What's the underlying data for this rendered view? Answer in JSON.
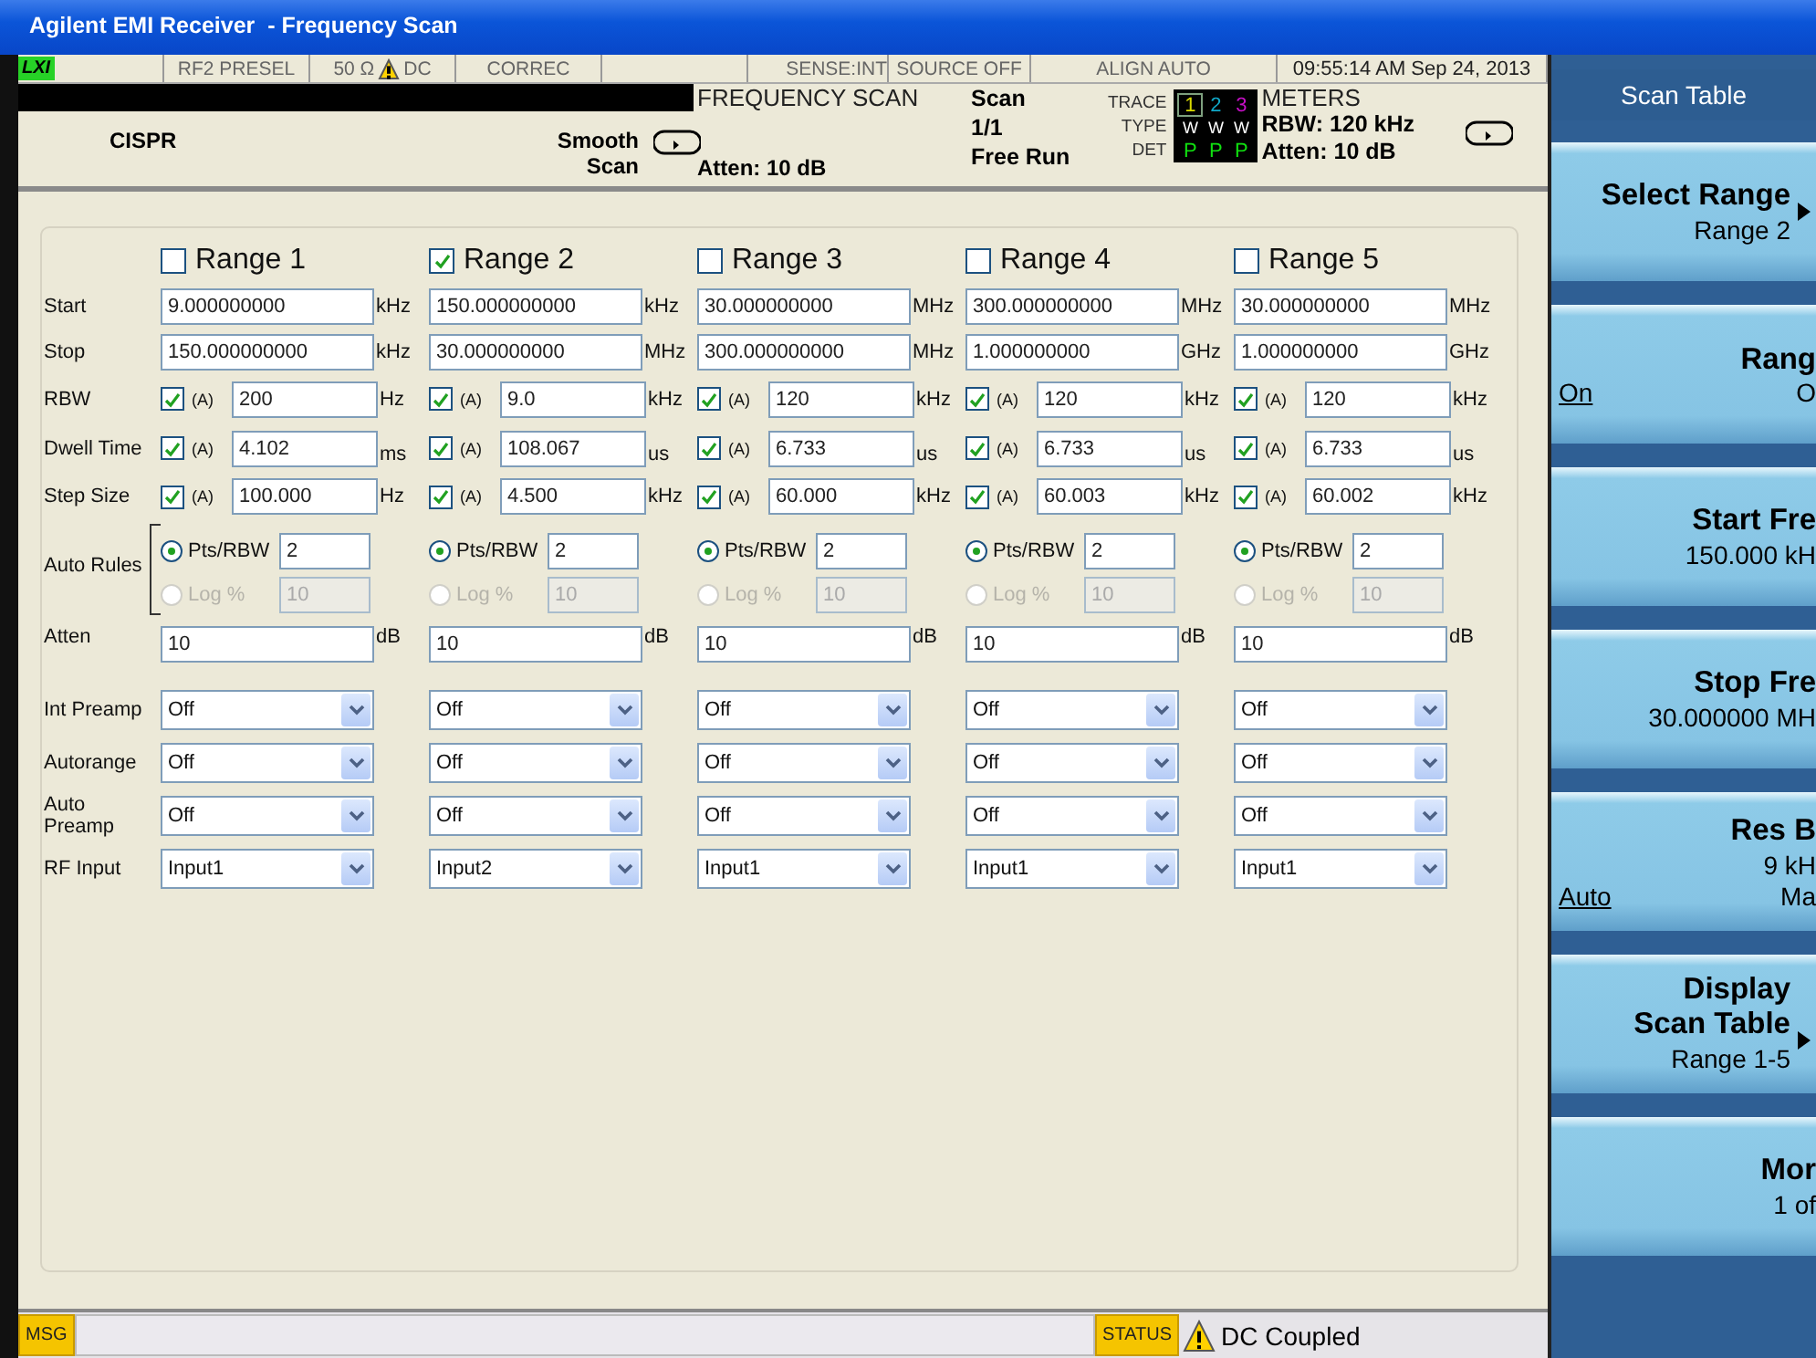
{
  "window": {
    "title": "Agilent EMI Receiver  - Frequency Scan"
  },
  "status_row": [
    {
      "kind": "logo",
      "text": "LXI"
    },
    {
      "kind": "text",
      "text": "RF2 PRESEL"
    },
    {
      "kind": "warning",
      "before": "50 Ω",
      "after": "DC"
    },
    {
      "kind": "text",
      "text": "CORREC"
    },
    {
      "kind": "blank"
    },
    {
      "kind": "text",
      "text": "SENSE:INT"
    },
    {
      "kind": "text",
      "text": "SOURCE OFF"
    },
    {
      "kind": "text",
      "text": "ALIGN AUTO"
    },
    {
      "kind": "text",
      "text": "09:55:14 AM Sep 24, 2013"
    }
  ],
  "annunciator": {
    "detector": "CISPR",
    "mode_top": "Smooth",
    "mode_bottom": "Scan",
    "measurement": "FREQUENCY SCAN",
    "atten": "Atten: 10 dB",
    "scan": [
      "Scan",
      "1/1",
      "Free Run"
    ],
    "trace_labels": [
      "TRACE",
      "TYPE",
      "DET"
    ],
    "traces": [
      {
        "number": "1",
        "selected": true,
        "color": "#d8d800",
        "type": "W",
        "det": "P"
      },
      {
        "number": "2",
        "selected": false,
        "color": "#10a8c8",
        "type": "W",
        "det": "P"
      },
      {
        "number": "3",
        "selected": false,
        "color": "#c810c8",
        "type": "W",
        "det": "P"
      }
    ],
    "meters": [
      "METERS",
      "RBW: 120 kHz",
      "Atten: 10 dB"
    ]
  },
  "table": {
    "ranges": [
      {
        "label": "Range 1",
        "checked": false
      },
      {
        "label": "Range 2",
        "checked": true
      },
      {
        "label": "Range 3",
        "checked": false
      },
      {
        "label": "Range 4",
        "checked": false
      },
      {
        "label": "Range 5",
        "checked": false
      }
    ],
    "rows": [
      {
        "kind": "value",
        "label": "Start",
        "cells": [
          {
            "value": "9.000000000",
            "unit": "kHz"
          },
          {
            "value": "150.000000000",
            "unit": "kHz"
          },
          {
            "value": "30.000000000",
            "unit": "MHz"
          },
          {
            "value": "300.000000000",
            "unit": "MHz"
          },
          {
            "value": "30.000000000",
            "unit": "MHz"
          }
        ]
      },
      {
        "kind": "value",
        "label": "Stop",
        "cells": [
          {
            "value": "150.000000000",
            "unit": "kHz"
          },
          {
            "value": "30.000000000",
            "unit": "MHz"
          },
          {
            "value": "300.000000000",
            "unit": "MHz"
          },
          {
            "value": "1.000000000",
            "unit": "GHz"
          },
          {
            "value": "1.000000000",
            "unit": "GHz"
          }
        ]
      },
      {
        "kind": "auto",
        "label": "RBW",
        "cells": [
          {
            "auto": true,
            "auto_label": "(A)",
            "value": "200",
            "unit": "Hz"
          },
          {
            "auto": true,
            "auto_label": "(A)",
            "value": "9.0",
            "unit": "kHz"
          },
          {
            "auto": true,
            "auto_label": "(A)",
            "value": "120",
            "unit": "kHz"
          },
          {
            "auto": true,
            "auto_label": "(A)",
            "value": "120",
            "unit": "kHz"
          },
          {
            "auto": true,
            "auto_label": "(A)",
            "value": "120",
            "unit": "kHz"
          }
        ]
      },
      {
        "kind": "auto",
        "label": "Dwell Time",
        "cells": [
          {
            "auto": true,
            "auto_label": "(A)",
            "value": "4.102",
            "unit": "ms"
          },
          {
            "auto": true,
            "auto_label": "(A)",
            "value": "108.067",
            "unit": "us"
          },
          {
            "auto": true,
            "auto_label": "(A)",
            "value": "6.733",
            "unit": "us"
          },
          {
            "auto": true,
            "auto_label": "(A)",
            "value": "6.733",
            "unit": "us"
          },
          {
            "auto": true,
            "auto_label": "(A)",
            "value": "6.733",
            "unit": "us"
          }
        ]
      },
      {
        "kind": "auto",
        "label": "Step Size",
        "cells": [
          {
            "auto": true,
            "auto_label": "(A)",
            "value": "100.000",
            "unit": "Hz"
          },
          {
            "auto": true,
            "auto_label": "(A)",
            "value": "4.500",
            "unit": "kHz"
          },
          {
            "auto": true,
            "auto_label": "(A)",
            "value": "60.000",
            "unit": "kHz"
          },
          {
            "auto": true,
            "auto_label": "(A)",
            "value": "60.003",
            "unit": "kHz"
          },
          {
            "auto": true,
            "auto_label": "(A)",
            "value": "60.002",
            "unit": "kHz"
          }
        ]
      },
      {
        "kind": "rules",
        "label": "Auto Rules",
        "cells": [
          {
            "options": [
              {
                "label": "Pts/RBW",
                "selected": true,
                "disabled": false,
                "value": "2"
              },
              {
                "label": "Log %",
                "selected": false,
                "disabled": true,
                "value": "10"
              }
            ]
          },
          {
            "options": [
              {
                "label": "Pts/RBW",
                "selected": true,
                "disabled": false,
                "value": "2"
              },
              {
                "label": "Log %",
                "selected": false,
                "disabled": true,
                "value": "10"
              }
            ]
          },
          {
            "options": [
              {
                "label": "Pts/RBW",
                "selected": true,
                "disabled": false,
                "value": "2"
              },
              {
                "label": "Log %",
                "selected": false,
                "disabled": true,
                "value": "10"
              }
            ]
          },
          {
            "options": [
              {
                "label": "Pts/RBW",
                "selected": true,
                "disabled": false,
                "value": "2"
              },
              {
                "label": "Log %",
                "selected": false,
                "disabled": true,
                "value": "10"
              }
            ]
          },
          {
            "options": [
              {
                "label": "Pts/RBW",
                "selected": true,
                "disabled": false,
                "value": "2"
              },
              {
                "label": "Log %",
                "selected": false,
                "disabled": true,
                "value": "10"
              }
            ]
          }
        ]
      },
      {
        "kind": "value",
        "label": "Atten",
        "cells": [
          {
            "value": "10",
            "unit": "dB"
          },
          {
            "value": "10",
            "unit": "dB"
          },
          {
            "value": "10",
            "unit": "dB"
          },
          {
            "value": "10",
            "unit": "dB"
          },
          {
            "value": "10",
            "unit": "dB"
          }
        ]
      },
      {
        "kind": "dropdown",
        "label": "Int Preamp",
        "cells": [
          {
            "value": "Off"
          },
          {
            "value": "Off"
          },
          {
            "value": "Off"
          },
          {
            "value": "Off"
          },
          {
            "value": "Off"
          }
        ]
      },
      {
        "kind": "dropdown",
        "label": "Autorange",
        "cells": [
          {
            "value": "Off"
          },
          {
            "value": "Off"
          },
          {
            "value": "Off"
          },
          {
            "value": "Off"
          },
          {
            "value": "Off"
          }
        ]
      },
      {
        "kind": "dropdown",
        "label": "Auto Preamp",
        "cells": [
          {
            "value": "Off"
          },
          {
            "value": "Off"
          },
          {
            "value": "Off"
          },
          {
            "value": "Off"
          },
          {
            "value": "Off"
          }
        ]
      },
      {
        "kind": "dropdown",
        "label": "RF Input",
        "cells": [
          {
            "value": "Input1"
          },
          {
            "value": "Input2"
          },
          {
            "value": "Input1"
          },
          {
            "value": "Input1"
          },
          {
            "value": "Input1"
          }
        ]
      }
    ]
  },
  "softkeys": {
    "title": "Scan Table",
    "keys": [
      {
        "kind": "submenu",
        "title": "Select Range",
        "value": "Range 2"
      },
      {
        "kind": "toggle",
        "title": "Rang",
        "options": [
          {
            "label": "On",
            "selected": true
          },
          {
            "label": "O",
            "selected": false
          }
        ]
      },
      {
        "kind": "value",
        "title": "Start Fre",
        "value": "150.000 kH"
      },
      {
        "kind": "value",
        "title": "Stop Fre",
        "value": "30.000000 MH"
      },
      {
        "kind": "toggle",
        "title": "Res B",
        "value": "9 kH",
        "options": [
          {
            "label": "Auto",
            "selected": true
          },
          {
            "label": "Ma",
            "selected": false
          }
        ]
      },
      {
        "kind": "submenu",
        "title": "Display\nScan Table",
        "value": "Range 1-5"
      },
      {
        "kind": "value",
        "title": "Mor",
        "value": "1 of"
      }
    ]
  },
  "message_bar": {
    "msg_label": "MSG",
    "status_label": "STATUS",
    "status_text": "DC Coupled"
  }
}
